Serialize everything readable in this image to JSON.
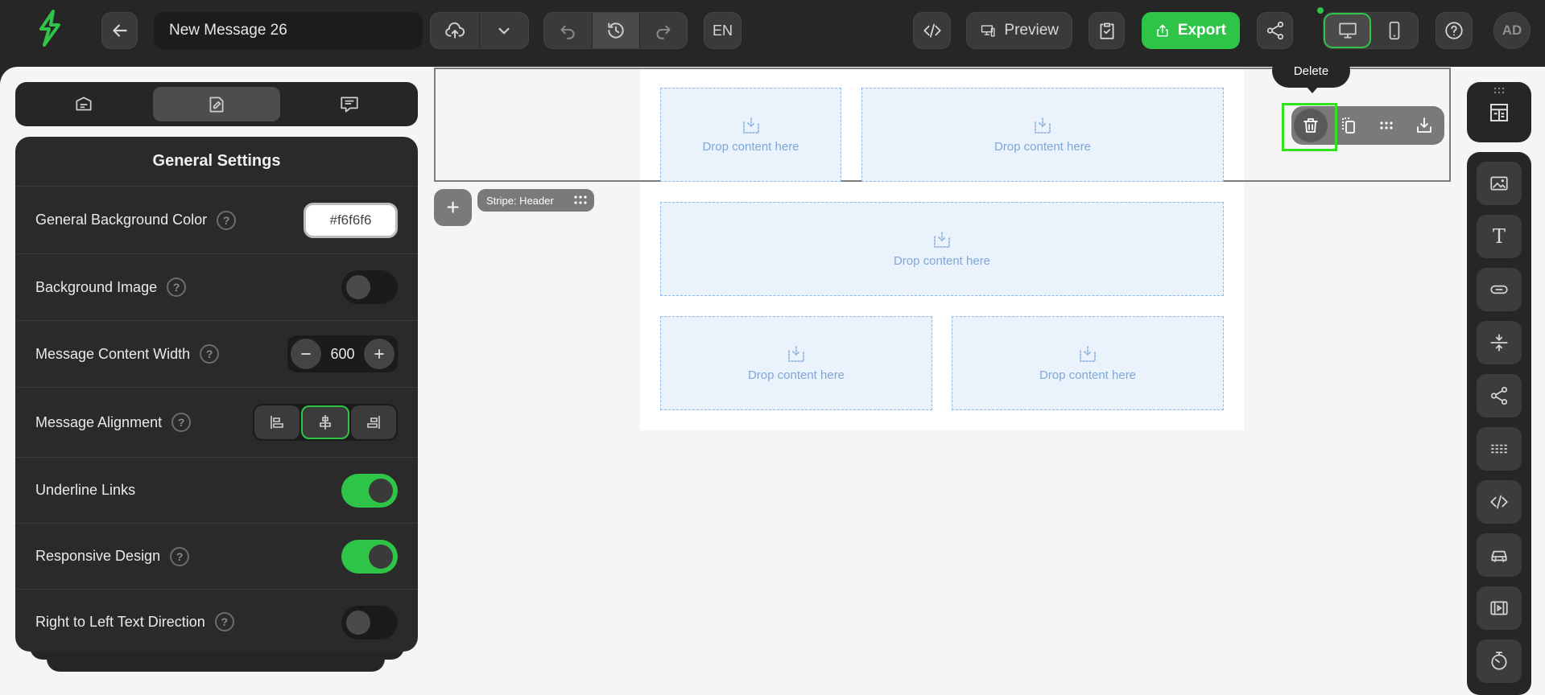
{
  "app": {
    "logo_icon": "lightning-logo-icon",
    "accent_color": "#2ec448"
  },
  "header": {
    "back_icon": "arrow-left-icon",
    "message_title": "New Message 26",
    "save_icon": "cloud-upload-icon",
    "save_menu_icon": "chevron-down-icon",
    "undo_icon": "undo-icon",
    "history_icon": "history-icon",
    "redo_icon": "redo-icon",
    "language": "EN",
    "code_icon": "code-icon",
    "preview_label": "Preview",
    "test_icon": "clipboard-check-icon",
    "export_label": "Export",
    "share_icon": "share-icon",
    "desktop_icon": "desktop-icon",
    "mobile_icon": "mobile-icon",
    "help_icon": "help-circle-icon",
    "avatar_initials": "AD"
  },
  "left_panel": {
    "tabs": [
      {
        "name": "content-tab",
        "icon": "content-blocks-icon",
        "selected": false
      },
      {
        "name": "settings-tab",
        "icon": "brush-settings-icon",
        "selected": true
      },
      {
        "name": "comments-tab",
        "icon": "comment-icon",
        "selected": false
      }
    ],
    "settings": {
      "title": "General Settings",
      "background_color_label": "General Background Color",
      "background_color_value": "#f6f6f6",
      "background_image_label": "Background Image",
      "background_image_on": false,
      "content_width_label": "Message Content Width",
      "content_width_value": "600",
      "alignment_label": "Message Alignment",
      "alignment_selected": "center",
      "underline_links_label": "Underline Links",
      "underline_links_on": true,
      "responsive_label": "Responsive Design",
      "responsive_on": true,
      "rtl_label": "Right to Left Text Direction",
      "rtl_on": false,
      "help_glyph": "?"
    }
  },
  "canvas": {
    "background": "#f5f5f5",
    "drop_text": "Drop content here",
    "stripe_label": "Stripe: Header",
    "add_row_glyph": "+",
    "tooltip": "Delete",
    "actions": [
      "delete-icon",
      "copy-icon",
      "more-icon",
      "save-block-icon"
    ]
  },
  "right_toolbar": {
    "top_icon": "structures-icon",
    "text_glyph": "T",
    "blocks": [
      "image-icon",
      "text-icon",
      "button-icon",
      "spacer-icon",
      "social-icon",
      "divider-icon",
      "html-icon",
      "amp-carousel-icon",
      "video-icon",
      "timer-icon"
    ]
  }
}
